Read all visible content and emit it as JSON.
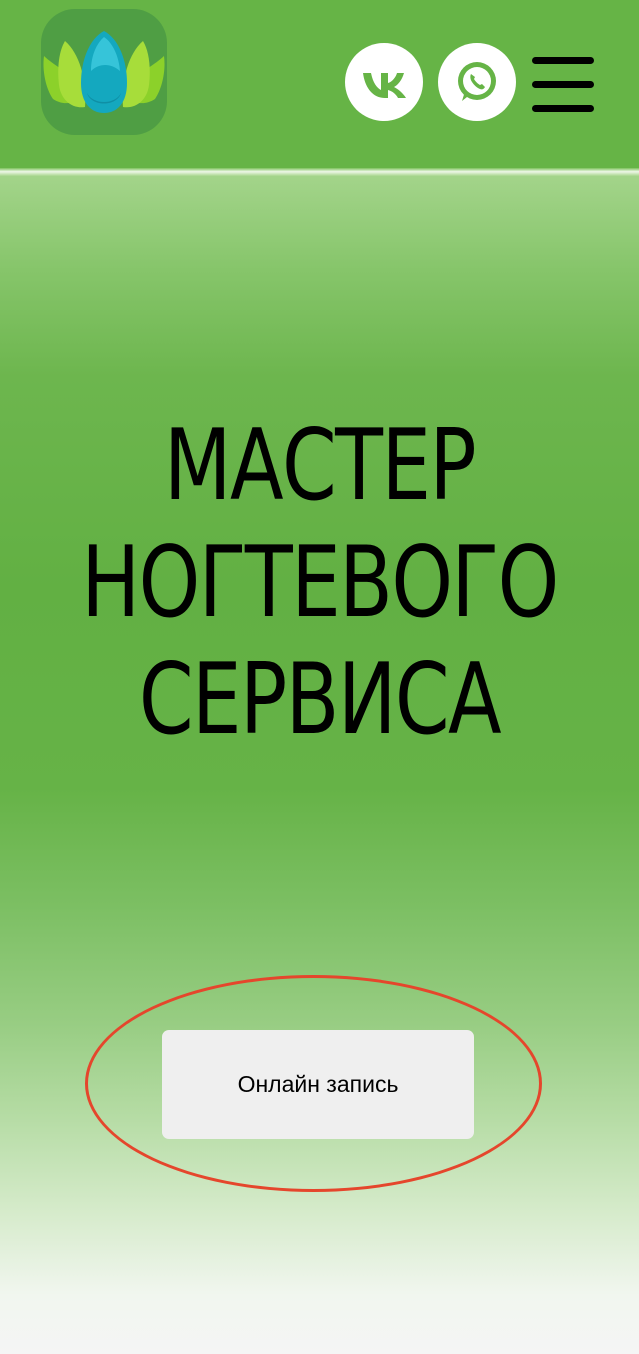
{
  "header": {
    "logo_icon": "lotus-logo-icon",
    "social": [
      {
        "name": "vk",
        "icon": "vk-icon"
      },
      {
        "name": "whatsapp",
        "icon": "whatsapp-icon"
      }
    ],
    "menu_icon": "hamburger-menu-icon"
  },
  "hero": {
    "title_lines": [
      "МАСТЕР",
      "НОГТЕВОГО",
      "СЕРВИСА"
    ],
    "cta_label": "Онлайн запись"
  },
  "colors": {
    "header_green": "#66b446",
    "hero_green": "#62b043",
    "button_bg": "#efefef",
    "highlight_ring": "#e5462c",
    "logo_teal": "#13b2c4",
    "logo_lime": "#8fd22b"
  }
}
